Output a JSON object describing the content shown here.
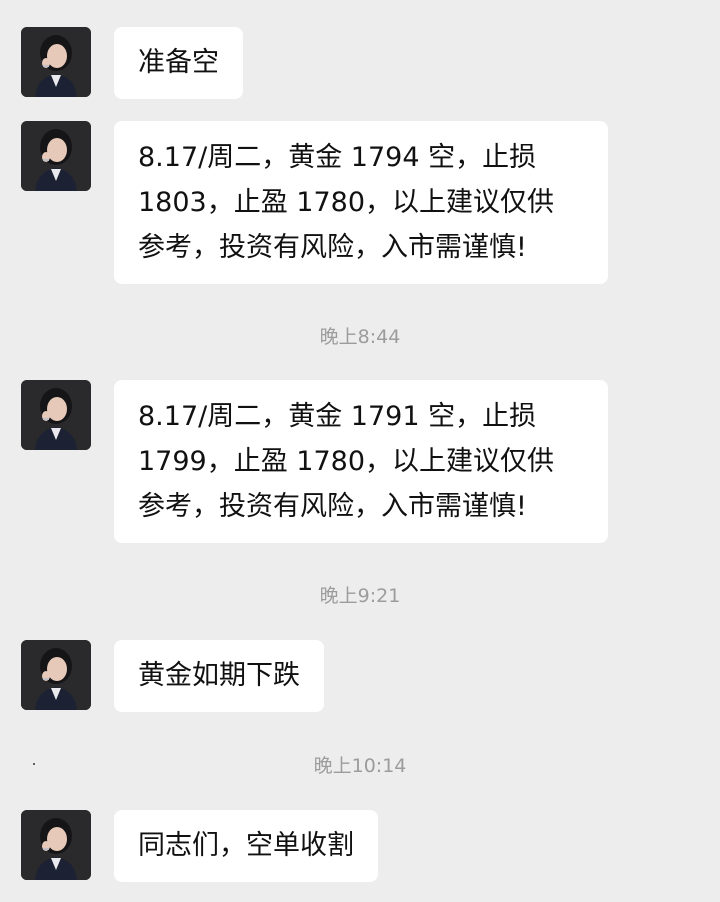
{
  "messages": [
    {
      "lines": [
        "准备空"
      ]
    },
    {
      "lines": [
        "8.17/周二，黄金 1794 空，止损",
        "1803，止盈 1780，以上建议仅供",
        "参考，投资有风险，入市需谨慎!"
      ]
    },
    {
      "lines": [
        "8.17/周二，黄金 1791 空，止损",
        "1799，止盈 1780，以上建议仅供",
        "参考，投资有风险，入市需谨慎!"
      ]
    },
    {
      "lines": [
        "黄金如期下跌"
      ]
    },
    {
      "lines": [
        "同志们，空单收割"
      ]
    }
  ],
  "timestamps": [
    "晚上8:44",
    "晚上9:21",
    "晚上10:14"
  ],
  "colors": {
    "background": "#ededed",
    "bubble": "#ffffff",
    "text": "#111111",
    "timestamp": "#9c9c9c"
  },
  "icons": {
    "avatar": "profile-photo-avatar"
  }
}
